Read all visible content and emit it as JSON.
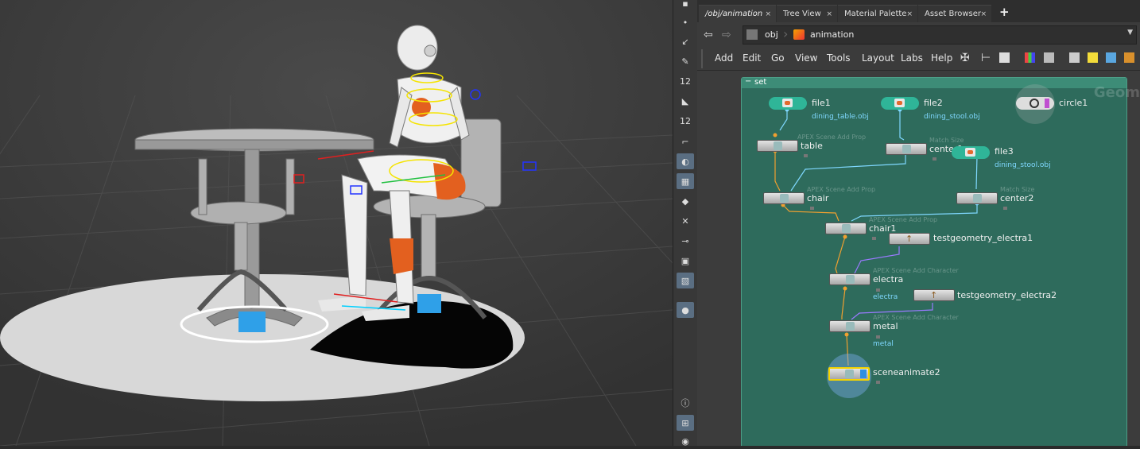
{
  "tabs": [
    {
      "label": "/obj/animation",
      "active": true
    },
    {
      "label": "Tree View",
      "active": false
    },
    {
      "label": "Material Palette",
      "active": false
    },
    {
      "label": "Asset Browser",
      "active": false
    }
  ],
  "tab_add": "+",
  "tab_close": "×",
  "path": {
    "root": "obj",
    "current": "animation"
  },
  "menu": [
    "Add",
    "Edit",
    "Go",
    "View",
    "Tools",
    "Layout",
    "Labs",
    "Help"
  ],
  "toolbar_numbers": {
    "a": "12",
    "b": "12"
  },
  "network": {
    "container": "set",
    "watermark": "Geom",
    "nodes": {
      "file1": {
        "label": "file1",
        "sub": "dining_table.obj"
      },
      "file2": {
        "label": "file2",
        "sub": "dining_stool.obj"
      },
      "circle1": {
        "label": "circle1"
      },
      "table": {
        "label": "table",
        "faint": "APEX Scene Add Prop"
      },
      "center1": {
        "label": "center1",
        "faint": "Match Size"
      },
      "file3": {
        "label": "file3",
        "sub": "dining_stool.obj"
      },
      "chair": {
        "label": "chair",
        "faint": "APEX Scene Add Prop"
      },
      "center2": {
        "label": "center2",
        "faint": "Match Size"
      },
      "chair1": {
        "label": "chair1",
        "faint": "APEX Scene Add Prop"
      },
      "testgeometry_electra1": {
        "label": "testgeometry_electra1"
      },
      "electra": {
        "label": "electra",
        "faint": "APEX Scene Add Character"
      },
      "testgeometry_electra2": {
        "label": "testgeometry_electra2",
        "sub": "electra"
      },
      "metal": {
        "label": "metal",
        "faint": "APEX Scene Add Character",
        "sub": "metal"
      },
      "sceneanimate2": {
        "label": "sceneanimate2"
      }
    }
  },
  "colors": {
    "network_bg": "#2e6b5c",
    "set_header": "#3d8c77",
    "selected_node": "#f5d300",
    "file_node": "#2fb598"
  }
}
